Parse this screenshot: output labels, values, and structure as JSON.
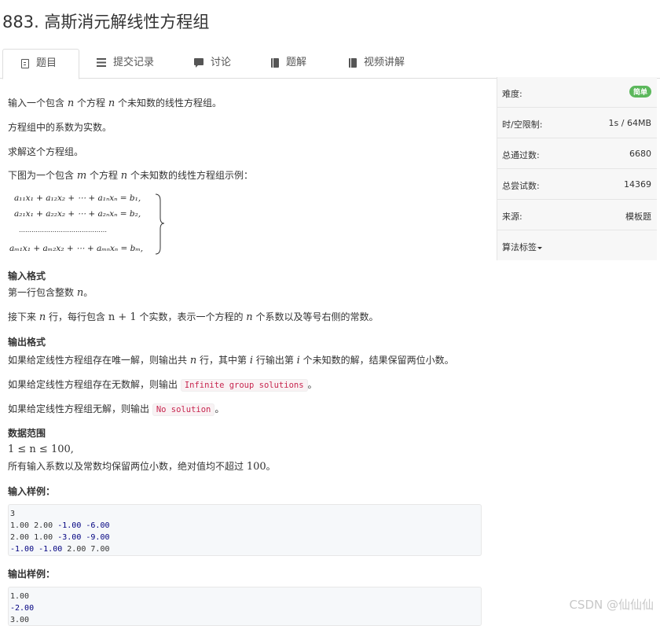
{
  "problem": {
    "title": "883. 高斯消元解线性方程组"
  },
  "tabs": [
    {
      "label": "题目",
      "icon": "document-icon"
    },
    {
      "label": "提交记录",
      "icon": "list-icon"
    },
    {
      "label": "讨论",
      "icon": "comment-icon"
    },
    {
      "label": "题解",
      "icon": "book-icon"
    },
    {
      "label": "视频讲解",
      "icon": "book-icon"
    }
  ],
  "statement": {
    "line1_a": "输入一个包含 ",
    "line1_var1": "n",
    "line1_b": " 个方程 ",
    "line1_var2": "n",
    "line1_c": " 个未知数的线性方程组。",
    "line2": "方程组中的系数为实数。",
    "line3": "求解这个方程组。",
    "line4_a": "下图为一个包含 ",
    "line4_var1": "m",
    "line4_b": " 个方程 ",
    "line4_var2": "n",
    "line4_c": " 个未知数的线性方程组示例："
  },
  "equation": {
    "rows": [
      "a₁₁x₁ + a₁₂x₂ + ⋯ + a₁ₙxₙ = b₁,",
      "a₂₁x₁ + a₂₂x₂ + ⋯ + a₂ₙxₙ = b₂,",
      "……………………………………",
      "aₘ₁x₁ + aₘ₂x₂ + ⋯ + aₘₙxₙ = bₘ,"
    ]
  },
  "input_format": {
    "heading": "输入格式",
    "l1_a": "第一行包含整数 ",
    "l1_var": "n",
    "l1_b": "。",
    "l2_a": "接下来 ",
    "l2_var1": "n",
    "l2_b": " 行，每行包含 ",
    "l2_expr": "n + 1",
    "l2_c": " 个实数，表示一个方程的 ",
    "l2_var2": "n",
    "l2_d": " 个系数以及等号右侧的常数。"
  },
  "output_format": {
    "heading": "输出格式",
    "l1_a": "如果给定线性方程组存在唯一解，则输出共 ",
    "l1_var1": "n",
    "l1_b": " 行，其中第 ",
    "l1_var2": "i",
    "l1_c": " 行输出第 ",
    "l1_var3": "i",
    "l1_d": " 个未知数的解，结果保留两位小数。",
    "l2_a": "如果给定线性方程组存在无数解，则输出 ",
    "l2_code": "Infinite group solutions",
    "l2_b": "。",
    "l3_a": "如果给定线性方程组无解，则输出 ",
    "l3_code": "No solution",
    "l3_b": "。"
  },
  "range": {
    "heading": "数据范围",
    "l1": "1 ≤ n ≤ 100,",
    "l2_a": "所有输入系数以及常数均保留两位小数，绝对值均不超过 ",
    "l2_num": "100",
    "l2_b": "。"
  },
  "sample_input": {
    "heading": "输入样例：",
    "lines": [
      "3",
      "1.00 2.00 -1.00 -6.00",
      "2.00 1.00 -3.00 -9.00",
      "-1.00 -1.00 2.00 7.00"
    ]
  },
  "sample_output": {
    "heading": "输出样例：",
    "lines": [
      "1.00",
      "-2.00",
      "3.00"
    ]
  },
  "sidebar": {
    "rows": [
      {
        "key": "难度:",
        "value": "简单",
        "badge": true
      },
      {
        "key": "时/空限制:",
        "value": "1s / 64MB"
      },
      {
        "key": "总通过数:",
        "value": "6680"
      },
      {
        "key": "总尝试数:",
        "value": "14369"
      },
      {
        "key": "来源:",
        "value": "模板题"
      },
      {
        "key": "算法标签",
        "value": "",
        "dropdown": true
      }
    ]
  },
  "watermark": "CSDN @仙仙仙"
}
